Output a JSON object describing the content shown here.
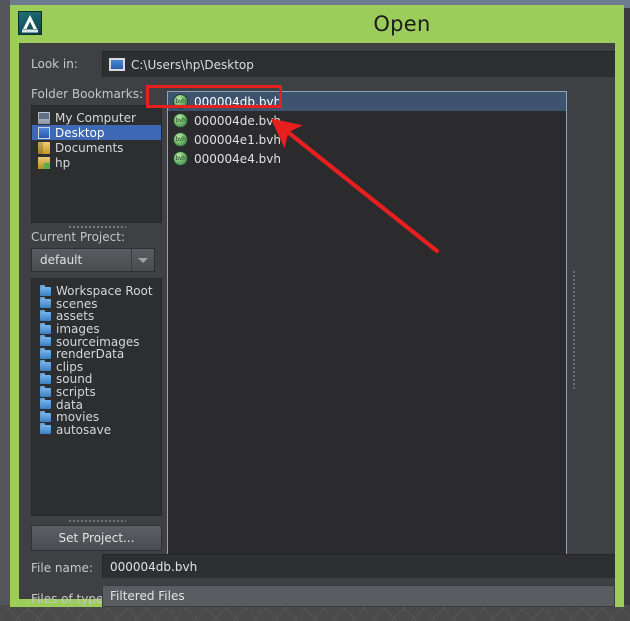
{
  "window": {
    "title": "Open",
    "app_icon": "maya-app-icon",
    "accent_color": "#9ccc5a",
    "body_color": "#3f4043"
  },
  "lookin": {
    "label": "Look in:",
    "icon": "monitor-icon",
    "path": "C:\\Users\\hp\\Desktop"
  },
  "bookmarks": {
    "label": "Folder Bookmarks:",
    "items": [
      {
        "label": "My Computer",
        "icon": "computer-icon",
        "selected": false
      },
      {
        "label": "Desktop",
        "icon": "desktop-icon",
        "selected": true
      },
      {
        "label": "Documents",
        "icon": "folder-icon",
        "selected": false
      },
      {
        "label": "hp",
        "icon": "user-folder-icon",
        "selected": false
      }
    ]
  },
  "project": {
    "label": "Current Project:",
    "selected": "default",
    "options": [
      "default"
    ],
    "set_project_button": "Set Project..."
  },
  "project_folders": {
    "items": [
      {
        "label": "Workspace Root"
      },
      {
        "label": "scenes"
      },
      {
        "label": "assets"
      },
      {
        "label": "images"
      },
      {
        "label": "sourceimages"
      },
      {
        "label": "renderData"
      },
      {
        "label": "clips"
      },
      {
        "label": "sound"
      },
      {
        "label": "scripts"
      },
      {
        "label": "data"
      },
      {
        "label": "movies"
      },
      {
        "label": "autosave"
      }
    ]
  },
  "files": {
    "items": [
      {
        "name": "000004db.bvh",
        "icon": "bvh-file-icon",
        "selected": true
      },
      {
        "name": "000004de.bvh",
        "icon": "bvh-file-icon",
        "selected": false
      },
      {
        "name": "000004e1.bvh",
        "icon": "bvh-file-icon",
        "selected": false
      },
      {
        "name": "000004e4.bvh",
        "icon": "bvh-file-icon",
        "selected": false
      }
    ]
  },
  "filename": {
    "label": "File name:",
    "value": "000004db.bvh",
    "placeholder": ""
  },
  "filetype": {
    "label": "Files of type:",
    "value": "Filtered Files",
    "options": [
      "Filtered Files"
    ]
  },
  "annotation": {
    "highlight_color": "#e81f1f",
    "arrow_color": "#e81f1f",
    "target": "000004db.bvh"
  }
}
